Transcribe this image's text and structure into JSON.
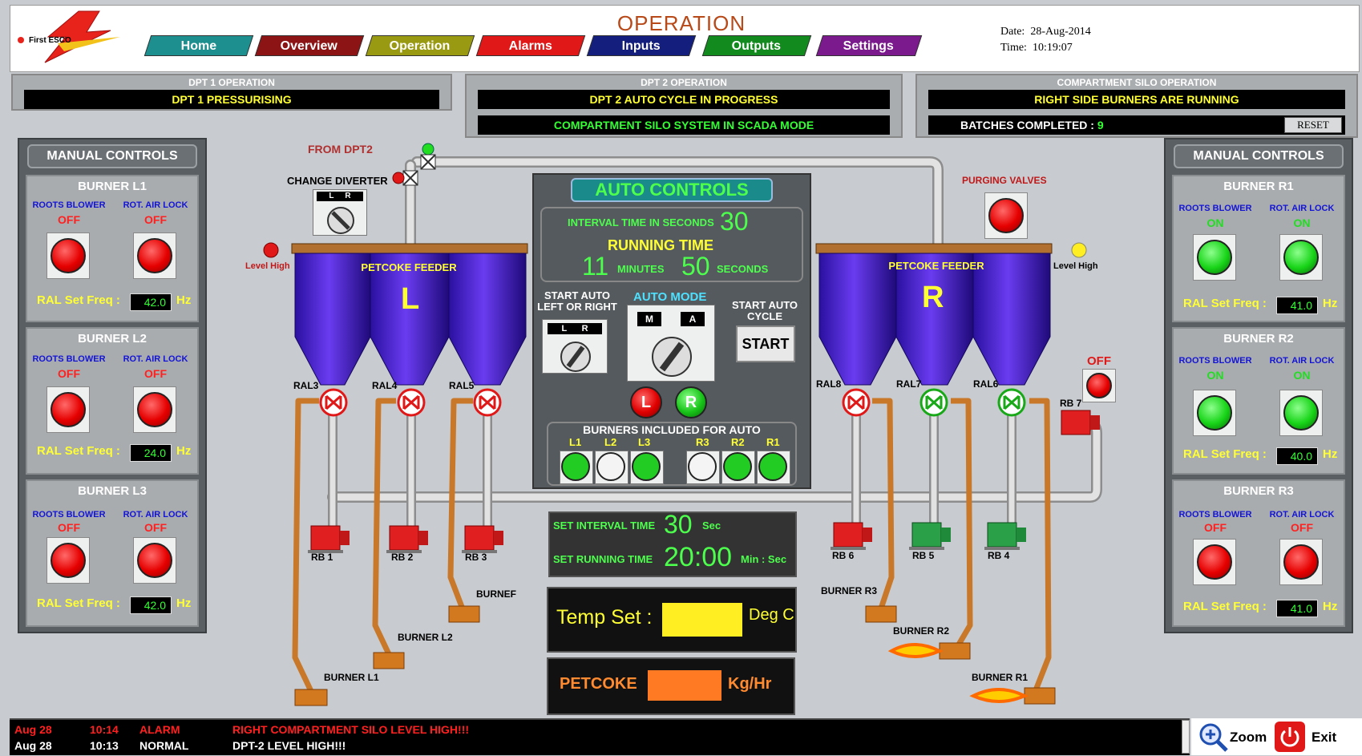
{
  "header": {
    "title": "OPERATION",
    "logo_text": "First ESCO",
    "tabs": [
      {
        "label": "Home",
        "color": "#1e8f8f"
      },
      {
        "label": "Overview",
        "color": "#8c1414"
      },
      {
        "label": "Operation",
        "color": "#9a9a12"
      },
      {
        "label": "Alarms",
        "color": "#e01818"
      },
      {
        "label": "Inputs",
        "color": "#141e7c"
      },
      {
        "label": "Outputs",
        "color": "#128a1e"
      },
      {
        "label": "Settings",
        "color": "#7a1a8c"
      }
    ],
    "date_label": "Date:",
    "date_value": "28-Aug-2014",
    "time_label": "Time:",
    "time_value": "10:19:07"
  },
  "status": {
    "dpt1_label": "DPT 1 OPERATION",
    "dpt1_value": "DPT 1 PRESSURISING",
    "dpt2_label": "DPT 2 OPERATION",
    "dpt2_value": "DPT 2 AUTO CYCLE IN PROGRESS",
    "scada_value": "COMPARTMENT SILO SYSTEM IN SCADA MODE",
    "silo_label": "COMPARTMENT SILO OPERATION",
    "silo_value": "RIGHT SIDE BURNERS ARE RUNNING",
    "batches_label": "BATCHES COMPLETED :",
    "batches_value": "9",
    "reset_label": "RESET"
  },
  "left_manual": {
    "title": "MANUAL CONTROLS",
    "burners": [
      {
        "name": "BURNER L1",
        "blower_label": "ROOTS BLOWER",
        "blower_state": "OFF",
        "lock_label": "ROT. AIR LOCK",
        "lock_state": "OFF",
        "ral_label": "RAL Set Freq :",
        "ral_value": "42.0",
        "unit": "Hz"
      },
      {
        "name": "BURNER L2",
        "blower_label": "ROOTS BLOWER",
        "blower_state": "OFF",
        "lock_label": "ROT. AIR LOCK",
        "lock_state": "OFF",
        "ral_label": "RAL Set Freq :",
        "ral_value": "24.0",
        "unit": "Hz"
      },
      {
        "name": "BURNER L3",
        "blower_label": "ROOTS BLOWER",
        "blower_state": "OFF",
        "lock_label": "ROT. AIR LOCK",
        "lock_state": "OFF",
        "ral_label": "RAL Set Freq :",
        "ral_value": "42.0",
        "unit": "Hz"
      }
    ]
  },
  "right_manual": {
    "title": "MANUAL CONTROLS",
    "burners": [
      {
        "name": "BURNER R1",
        "blower_label": "ROOTS BLOWER",
        "blower_state": "ON",
        "lock_label": "ROT. AIR LOCK",
        "lock_state": "ON",
        "ral_label": "RAL Set Freq :",
        "ral_value": "41.0",
        "unit": "Hz"
      },
      {
        "name": "BURNER R2",
        "blower_label": "ROOTS BLOWER",
        "blower_state": "ON",
        "lock_label": "ROT. AIR LOCK",
        "lock_state": "ON",
        "ral_label": "RAL Set Freq :",
        "ral_value": "40.0",
        "unit": "Hz"
      },
      {
        "name": "BURNER R3",
        "blower_label": "ROOTS BLOWER",
        "blower_state": "OFF",
        "lock_label": "ROT. AIR LOCK",
        "lock_state": "OFF",
        "ral_label": "RAL Set Freq :",
        "ral_value": "41.0",
        "unit": "Hz"
      }
    ]
  },
  "auto": {
    "title": "AUTO CONTROLS",
    "interval_label": "INTERVAL TIME IN SECONDS",
    "interval_value": "30",
    "running_label": "RUNNING TIME",
    "running_minutes": "11",
    "minutes_label": "MINUTES",
    "running_seconds": "50",
    "seconds_label": "SECONDS",
    "start_lr_label": "START AUTO LEFT OR RIGHT",
    "auto_mode_label": "AUTO MODE",
    "start_cycle_label": "START AUTO CYCLE",
    "start_button": "START",
    "sw_l": "L",
    "sw_r": "R",
    "sw_m": "M",
    "sw_a": "A",
    "btn_l": "L",
    "btn_r": "R",
    "included_label": "BURNERS INCLUDED FOR AUTO",
    "included": [
      {
        "label": "L1",
        "state": "green"
      },
      {
        "label": "L2",
        "state": "white"
      },
      {
        "label": "L3",
        "state": "green"
      },
      {
        "label": "R3",
        "state": "white"
      },
      {
        "label": "R2",
        "state": "green"
      },
      {
        "label": "R1",
        "state": "green"
      }
    ]
  },
  "setpoints": {
    "interval_label": "SET INTERVAL TIME",
    "interval_value": "30",
    "interval_unit": "Sec",
    "running_label": "SET RUNNING TIME",
    "running_value": "20:00",
    "running_unit": "Min : Sec",
    "temp_label": "Temp Set :",
    "temp_unit": "Deg C",
    "petcoke_label": "PETCOKE",
    "petcoke_unit": "Kg/Hr"
  },
  "process": {
    "from_dpt2": "FROM DPT2",
    "change_diverter": "CHANGE DIVERTER",
    "purging_valves": "PURGING VALVES",
    "level_high_l": "Level High",
    "level_high_r": "Level High",
    "feeder_l_title": "PETCOKE FEEDER",
    "feeder_l_letter": "L",
    "feeder_r_title": "PETCOKE FEEDER",
    "feeder_r_letter": "R",
    "rb7_state": "OFF",
    "ral_labels_left": [
      "RAL3",
      "RAL4",
      "RAL5"
    ],
    "ral_labels_right": [
      "RAL8",
      "RAL7",
      "RAL6"
    ],
    "rb_labels_left": [
      "RB 1",
      "RB 2",
      "RB 3"
    ],
    "rb_labels_right": [
      "RB 6",
      "RB 5",
      "RB 4"
    ],
    "rb7": "RB 7",
    "burner_labels": {
      "l1": "BURNER L1",
      "l2": "BURNER L2",
      "l3": "BURNEF",
      "r3": "BURNER R3",
      "r2": "BURNER R2",
      "r1": "BURNER R1"
    }
  },
  "alarms": [
    {
      "date": "Aug 28",
      "time": "10:14",
      "type": "ALARM",
      "message": "RIGHT COMPARTMENT SILO LEVEL HIGH!!!",
      "color": "#ff2020"
    },
    {
      "date": "Aug 28",
      "time": "10:13",
      "type": "NORMAL",
      "message": "DPT-2 LEVEL HIGH!!!",
      "color": "#ffffff"
    }
  ],
  "footer": {
    "zoom_label": "Zoom",
    "exit_label": "Exit"
  }
}
